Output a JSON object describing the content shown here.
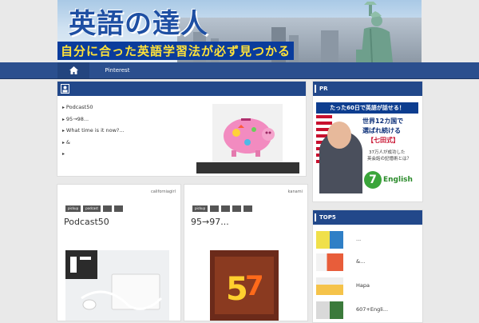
{
  "header": {
    "title": "英語の達人",
    "subtitle": "自分に合った英語学習法が必ず見つかる"
  },
  "nav": {
    "home_icon": "home-icon",
    "items": [
      {
        "label": "Pinterest"
      }
    ]
  },
  "main_panel": {
    "list": [
      {
        "label": "Podcast50"
      },
      {
        "label": "95→98..."
      },
      {
        "label": "What time is it now?..."
      },
      {
        "label": "&"
      },
      {
        "label": ""
      }
    ]
  },
  "cards": [
    {
      "author": "californiagirl",
      "tags": [
        "pickup",
        "podcast",
        "",
        ""
      ],
      "title": "Podcast50"
    },
    {
      "author": "kanami",
      "tags": [
        "pickup",
        "",
        "",
        "",
        ""
      ],
      "title": "95→97..."
    }
  ],
  "sidebar": {
    "pr": {
      "heading": "PR",
      "ad_headline": "たった60日で英語が話せる！",
      "ad_line1": "世界12カ国で",
      "ad_line2": "選ばれ続ける",
      "ad_line3": "【七田式】",
      "ad_note1": "37万人が成功した",
      "ad_note2": "英会話の記憶術とは？",
      "ad_brand": "English"
    },
    "top5": {
      "heading": "TOP5",
      "items": [
        {
          "label": "..."
        },
        {
          "label": "&..."
        },
        {
          "label": "Hapa"
        },
        {
          "label": "607+Engli..."
        }
      ]
    }
  },
  "colors": {
    "brand_blue": "#22488a",
    "nav_blue": "#2b4f8e",
    "accent_yellow": "#ffe23a"
  }
}
